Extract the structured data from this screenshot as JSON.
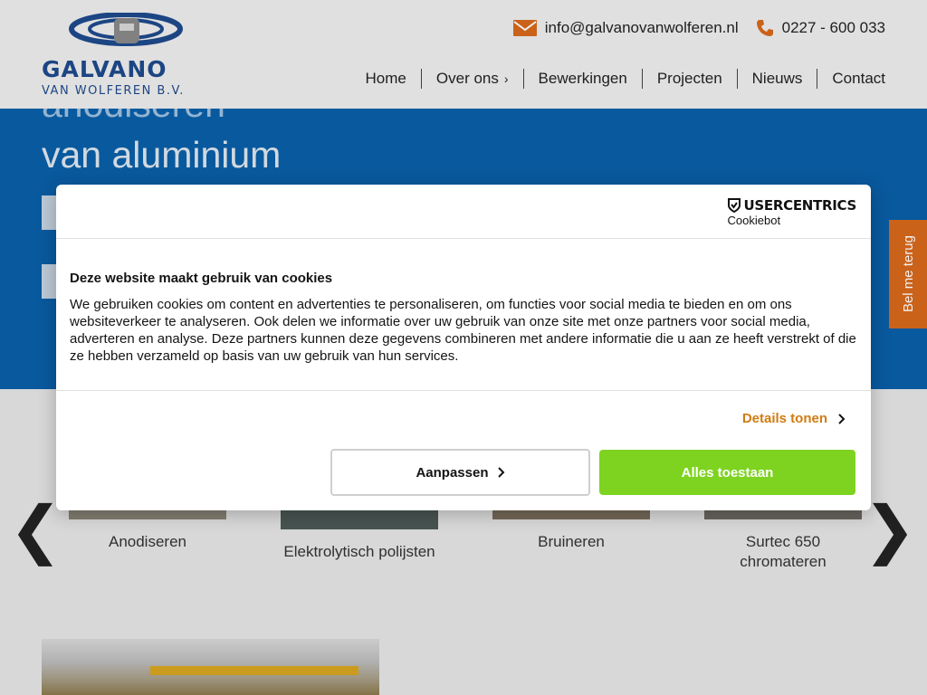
{
  "header": {
    "logo": {
      "name": "GALVANO",
      "subtitle": "VAN WOLFEREN B.V."
    },
    "contact": {
      "email": "info@galvanovanwolferen.nl",
      "phone": "0227 - 600 033"
    },
    "nav": [
      {
        "label": "Home"
      },
      {
        "label": "Over ons",
        "has_submenu": true,
        "submenu_icon": "›"
      },
      {
        "label": "Bewerkingen"
      },
      {
        "label": "Projecten"
      },
      {
        "label": "Nieuws"
      },
      {
        "label": "Contact"
      }
    ]
  },
  "hero": {
    "line1": "anodiseren",
    "line2": "van aluminium"
  },
  "callback": {
    "label": "Bel me terug"
  },
  "carousel": {
    "prev_icon": "❮",
    "next_icon": "❯",
    "tiles": [
      {
        "label": "Anodiseren"
      },
      {
        "label": "Elektrolytisch polijsten"
      },
      {
        "label": "Bruineren"
      },
      {
        "label": "Surtec 650 chromateren"
      }
    ]
  },
  "cookie_dialog": {
    "brand": "USERCENTRICS",
    "brand_sub": "Cookiebot",
    "heading": "Deze website maakt gebruik van cookies",
    "body": "We gebruiken cookies om content en advertenties te personaliseren, om functies voor social media te bieden en om ons websiteverkeer te analyseren. Ook delen we informatie over uw gebruik van onze site met onze partners voor social media, adverteren en analyse. Deze partners kunnen deze gegevens combineren met andere informatie die u aan ze heeft verstrekt of die ze hebben verzameld op basis van uw gebruik van hun services.",
    "details_label": "Details tonen",
    "customize_label": "Aanpassen",
    "allow_all_label": "Alles toestaan"
  },
  "colors": {
    "brand_blue": "#1e4a8c",
    "hero_blue": "#0a5fa8",
    "accent_orange": "#d7691c",
    "details_orange": "#d27b12",
    "allow_green": "#7ed321"
  }
}
